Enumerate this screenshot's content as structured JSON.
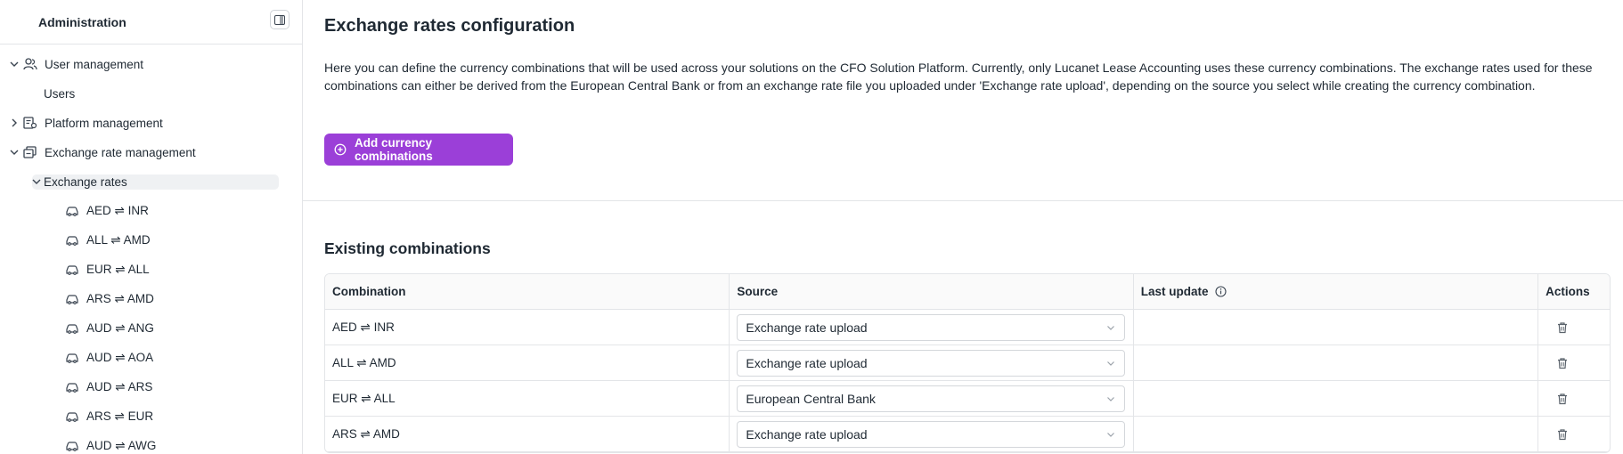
{
  "sidebar": {
    "title": "Administration",
    "items": [
      {
        "label": "User management"
      },
      {
        "label": "Users"
      },
      {
        "label": "Platform management"
      },
      {
        "label": "Exchange rate management"
      },
      {
        "label": "Exchange rates"
      }
    ],
    "rates": [
      "AED ⇌ INR",
      "ALL ⇌ AMD",
      "EUR ⇌ ALL",
      "ARS ⇌ AMD",
      "AUD ⇌ ANG",
      "AUD ⇌ AOA",
      "AUD ⇌ ARS",
      "ARS ⇌ EUR",
      "AUD ⇌ AWG"
    ]
  },
  "main": {
    "title": "Exchange rates configuration",
    "description": "Here you can define the currency combinations that will be used across your solutions on the CFO Solution Platform. Currently, only Lucanet Lease Accounting uses these currency combinations. The exchange rates used for these combinations can either be derived from the European Central Bank or from an exchange rate file you uploaded under 'Exchange rate upload', depending on the source you select while creating the currency combination.",
    "add_button": "Add currency combinations",
    "section_title": "Existing combinations",
    "table": {
      "headers": [
        "Combination",
        "Source",
        "Last update",
        "Actions"
      ],
      "rows": [
        {
          "combination": "AED ⇌ INR",
          "source": "Exchange rate upload",
          "last_update": ""
        },
        {
          "combination": "ALL ⇌ AMD",
          "source": "Exchange rate upload",
          "last_update": ""
        },
        {
          "combination": "EUR ⇌ ALL",
          "source": "European Central Bank",
          "last_update": ""
        },
        {
          "combination": "ARS ⇌ AMD",
          "source": "Exchange rate upload",
          "last_update": ""
        }
      ]
    }
  },
  "colors": {
    "accent": "#9b3fd8",
    "border": "#e3e5e8",
    "text": "#1f2933"
  }
}
